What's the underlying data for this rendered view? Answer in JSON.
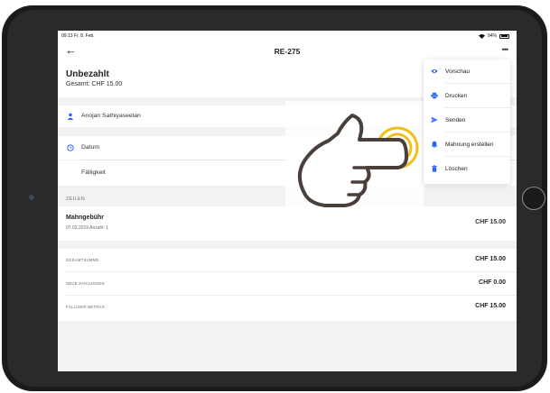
{
  "colors": {
    "accent": "#2962ff",
    "hand_ring": "#f2c01e",
    "hand_outline": "#4a3f3a"
  },
  "status_bar": {
    "time": "09:13  Fr. 8. Feb.",
    "battery": "94%",
    "battery_level": 0.94
  },
  "nav": {
    "back_icon": "arrow-left-icon",
    "title": "RE-275",
    "more_icon": "more-horizontal-icon"
  },
  "invoice": {
    "status": "Unbezahlt",
    "total": "Gesamt: CHF 15.00"
  },
  "fields": {
    "customer": "Anojan Sathiyaseelan",
    "date_label": "Datum",
    "due_label": "Fälligkeit"
  },
  "lines_section": "ZEILEN",
  "line_items": [
    {
      "title": "Mahngebühr",
      "sub": "07.02.2019   Anzahl: 1",
      "amount": "CHF 15.00"
    }
  ],
  "totals": [
    {
      "label": "GESAMTSUMME",
      "value": "CHF 15.00"
    },
    {
      "label": "NEUE ZAHLUNGEN",
      "value": "CHF 0.00"
    },
    {
      "label": "FÄLLIGER BETRAG",
      "value": "CHF 15.00"
    }
  ],
  "menu": [
    {
      "label": "Vorschau",
      "icon": "eye-icon"
    },
    {
      "label": "Drucken",
      "icon": "printer-icon"
    },
    {
      "label": "Senden",
      "icon": "send-icon"
    },
    {
      "label": "Mahnung erstellen",
      "icon": "bell-icon"
    },
    {
      "label": "Löschen",
      "icon": "trash-icon"
    }
  ]
}
